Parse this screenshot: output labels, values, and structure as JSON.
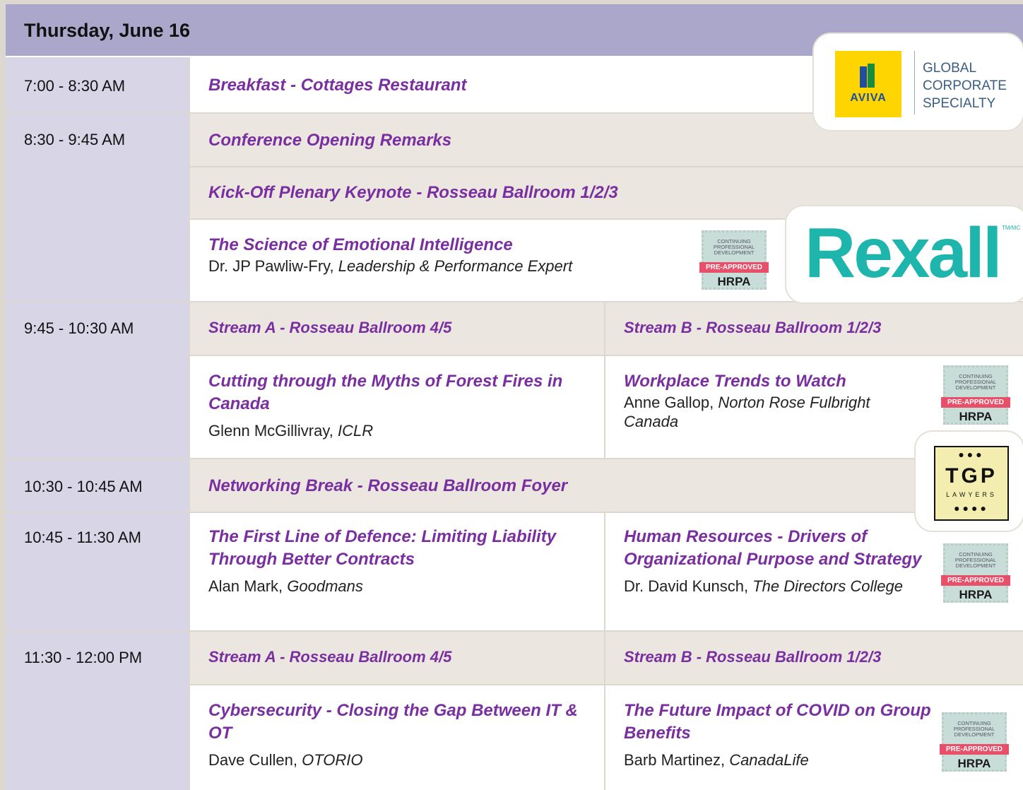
{
  "day_title": "Thursday, June 16",
  "rows": {
    "r1_time": "7:00 - 8:30 AM",
    "r1_title": "Breakfast - Cottages Restaurant",
    "r2_time": "8:30 - 9:45 AM",
    "r2_title": "Conference Opening Remarks",
    "r2_sub": "Kick-Off Plenary Keynote - Rosseau Ballroom 1/2/3",
    "r2_session": "The Science of Emotional Intelligence",
    "r2_speaker": "Dr. JP Pawliw-Fry,",
    "r2_speaker_role": "Leadership & Performance Expert",
    "r3_time": "9:45 - 10:30 AM",
    "r3_streamA": "Stream A - Rosseau Ballroom 4/5",
    "r3_streamB": "Stream B - Rosseau Ballroom 1/2/3",
    "r3_a_session": "Cutting through the Myths of Forest Fires in Canada",
    "r3_a_speaker": "Glenn McGillivray,",
    "r3_a_org": "ICLR",
    "r3_b_session": "Workplace Trends to Watch",
    "r3_b_speaker": "Anne Gallop,",
    "r3_b_org": "Norton Rose Fulbright Canada",
    "r4_time": "10:30 - 10:45 AM",
    "r4_title": "Networking Break - Rosseau Ballroom Foyer",
    "r5_time": "10:45 - 11:30 AM",
    "r5_a_session": "The First Line of Defence: Limiting Liability Through Better Contracts",
    "r5_a_speaker": "Alan Mark,",
    "r5_a_org": "Goodmans",
    "r5_b_session": "Human Resources - Drivers of Organizational Purpose and Strategy",
    "r5_b_speaker": "Dr. David Kunsch,",
    "r5_b_org": "The Directors College",
    "r6_time": "11:30 - 12:00 PM",
    "r6_streamA": "Stream A - Rosseau Ballroom 4/5",
    "r6_streamB": "Stream B - Rosseau Ballroom 1/2/3",
    "r6_a_session": "Cybersecurity - Closing the Gap Between IT & OT",
    "r6_a_speaker": "Dave Cullen,",
    "r6_a_org": "OTORIO",
    "r6_b_session": "The Future Impact of COVID on Group Benefits",
    "r6_b_speaker": "Barb Martinez,",
    "r6_b_org": "CanadaLife"
  },
  "badge": {
    "line1": "CONTINUING",
    "line2": "PROFESSIONAL",
    "line3": "DEVELOPMENT",
    "ribbon": "PRE-APPROVED",
    "org": "HRPA"
  },
  "sponsors": {
    "aviva_mark": "AVIVA",
    "aviva_l1": "GLOBAL",
    "aviva_l2": "CORPORATE",
    "aviva_l3": "SPECIALTY",
    "rexall": "Rexall",
    "rexall_tm": "TM/MC",
    "tgp": "TGP",
    "tgp_sub": "LAWYERS"
  },
  "colors": {
    "header": "#aba7cb",
    "time_col": "#d7d5e6",
    "beige": "#ebe7e0",
    "title_purple": "#7a2fa0",
    "rexall_teal": "#1db5ac",
    "aviva_yellow": "#ffd500",
    "aviva_blue": "#1d4ea1",
    "tgp_yellow": "#f3eeb0"
  }
}
